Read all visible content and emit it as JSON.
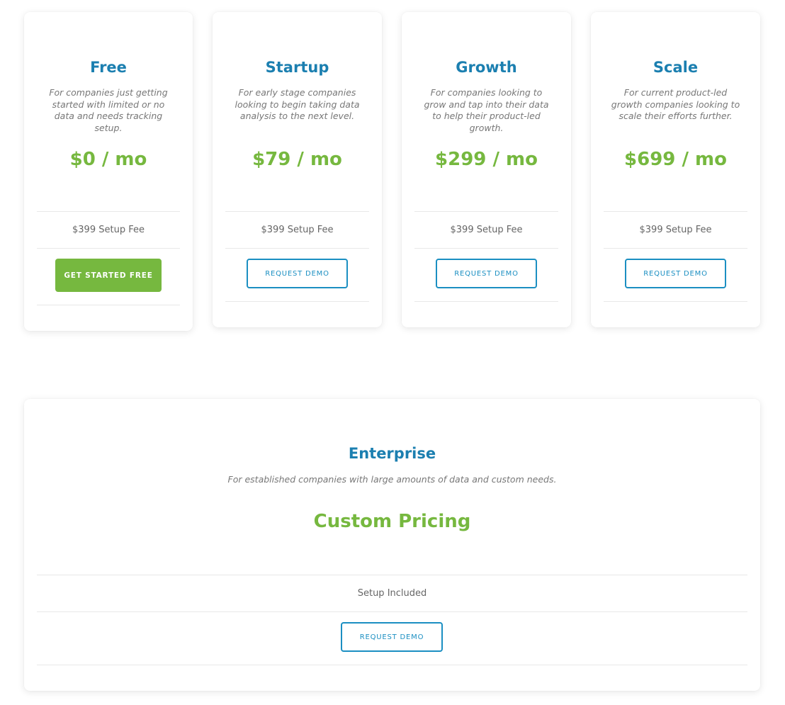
{
  "colors": {
    "title": "#1b7fb0",
    "price": "#76b83f",
    "accent_button": "#76b83f",
    "outline_button": "#1b8fc2"
  },
  "plans": [
    {
      "name": "Free",
      "description": "For companies just getting started with limited or no data and needs tracking setup.",
      "price": "$0 / mo",
      "fee": "$399 Setup Fee",
      "button": "GET STARTED FREE"
    },
    {
      "name": "Startup",
      "description": "For early stage companies looking to begin taking data analysis to the next level.",
      "price": "$79 / mo",
      "fee": "$399 Setup Fee",
      "button": "REQUEST DEMO"
    },
    {
      "name": "Growth",
      "description": "For companies looking to grow and tap into their data to help their product-led growth.",
      "price": "$299 / mo",
      "fee": "$399 Setup Fee",
      "button": "REQUEST DEMO"
    },
    {
      "name": "Scale",
      "description": "For current product-led growth companies looking to scale their efforts further.",
      "price": "$699 / mo",
      "fee": "$399 Setup Fee",
      "button": "REQUEST DEMO"
    }
  ],
  "enterprise": {
    "name": "Enterprise",
    "description": "For established companies with large amounts of data and custom needs.",
    "price": "Custom Pricing",
    "fee": "Setup Included",
    "button": "REQUEST DEMO"
  }
}
